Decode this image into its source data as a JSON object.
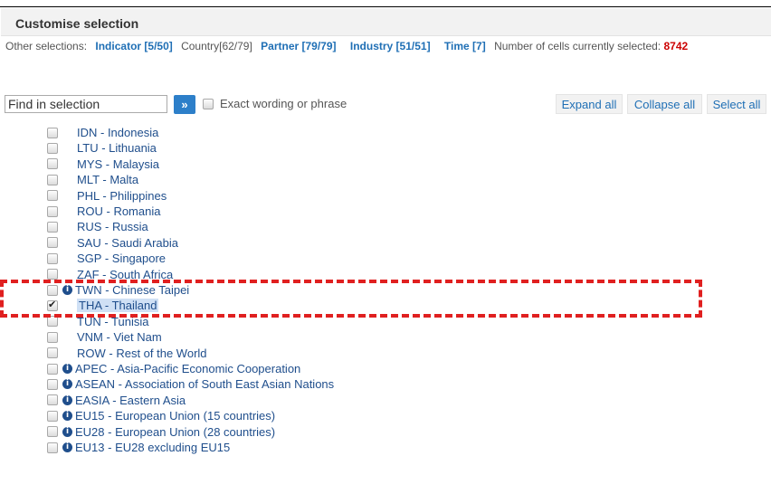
{
  "header": {
    "title": "Customise selection"
  },
  "selections": {
    "prefix": "Other selections:",
    "indicator": "Indicator [5/50]",
    "country": "Country[62/79]",
    "partner": "Partner [79/79]",
    "industry": "Industry [51/51]",
    "time": "Time [7]",
    "cells_label": "Number of cells currently selected:",
    "cells_value": "8742"
  },
  "search": {
    "placeholder": "Find in selection",
    "go_label": "»",
    "exact_label": "Exact wording or phrase"
  },
  "actions": {
    "expand": "Expand all",
    "collapse": "Collapse all",
    "select": "Select all"
  },
  "items": [
    {
      "label": "IDN - Indonesia",
      "info": false,
      "checked": false
    },
    {
      "label": "LTU - Lithuania",
      "info": false,
      "checked": false
    },
    {
      "label": "MYS - Malaysia",
      "info": false,
      "checked": false
    },
    {
      "label": "MLT - Malta",
      "info": false,
      "checked": false
    },
    {
      "label": "PHL - Philippines",
      "info": false,
      "checked": false
    },
    {
      "label": "ROU - Romania",
      "info": false,
      "checked": false
    },
    {
      "label": "RUS - Russia",
      "info": false,
      "checked": false
    },
    {
      "label": "SAU - Saudi Arabia",
      "info": false,
      "checked": false
    },
    {
      "label": "SGP - Singapore",
      "info": false,
      "checked": false
    },
    {
      "label": "ZAF - South Africa",
      "info": false,
      "checked": false
    },
    {
      "label": "TWN - Chinese Taipei",
      "info": true,
      "checked": false
    },
    {
      "label": "THA - Thailand",
      "info": false,
      "checked": true
    },
    {
      "label": "TUN - Tunisia",
      "info": false,
      "checked": false
    },
    {
      "label": "VNM - Viet Nam",
      "info": false,
      "checked": false
    },
    {
      "label": "ROW - Rest of the World",
      "info": false,
      "checked": false
    },
    {
      "label": "APEC - Asia-Pacific Economic Cooperation",
      "info": true,
      "checked": false
    },
    {
      "label": "ASEAN - Association of South East Asian Nations",
      "info": true,
      "checked": false
    },
    {
      "label": "EASIA - Eastern Asia",
      "info": true,
      "checked": false
    },
    {
      "label": "EU15 - European Union (15 countries)",
      "info": true,
      "checked": false
    },
    {
      "label": "EU28 - European Union (28 countries)",
      "info": true,
      "checked": false
    },
    {
      "label": "EU13 - EU28 excluding EU15",
      "info": true,
      "checked": false
    }
  ],
  "colors": {
    "link": "#1f6fb5",
    "item_text": "#1f4e8c",
    "count": "#cc0000",
    "highlight_box": "#e02020"
  }
}
